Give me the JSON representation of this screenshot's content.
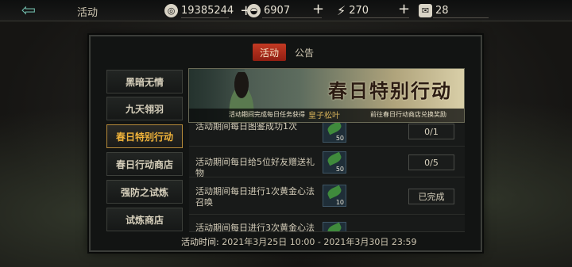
{
  "header": {
    "title": "活动",
    "back_icon": "back-arrow-icon",
    "currencies": [
      {
        "icon": "coin-icon",
        "value": "19385244"
      },
      {
        "icon": "ingot-icon",
        "value": "6907"
      },
      {
        "icon": "lightning-icon",
        "value": "270"
      },
      {
        "icon": "ticket-icon",
        "value": "28"
      }
    ]
  },
  "tabs": [
    {
      "label": "活动",
      "active": true
    },
    {
      "label": "公告",
      "active": false
    }
  ],
  "sidebar": [
    {
      "label": "黑暗无情"
    },
    {
      "label": "九天翎羽"
    },
    {
      "label": "春日特别行动",
      "active": true
    },
    {
      "label": "春日行动商店"
    },
    {
      "label": "强防之试炼"
    },
    {
      "label": "试炼商店"
    }
  ],
  "banner": {
    "title": "春日特别行动",
    "caption_left": "活动期间完成每日任务获得",
    "caption_item": "皇子松叶",
    "caption_right": "前往春日行动商店兑换奖励"
  },
  "tasks": [
    {
      "text": "活动期间每日图鉴成功1次",
      "reward": "50",
      "status": "0/1"
    },
    {
      "text": "活动期间每日给5位好友赠送礼物",
      "reward": "50",
      "status": "0/5"
    },
    {
      "text": "活动期间每日进行1次黄金心法召唤",
      "reward": "10",
      "status": "已完成"
    },
    {
      "text": "活动期间每日进行3次黄金心法召",
      "reward": "",
      "status": ""
    }
  ],
  "footer": {
    "label": "活动时间:",
    "range": "2021年3月25日 10:00 - 2021年3月30日 23:59"
  }
}
